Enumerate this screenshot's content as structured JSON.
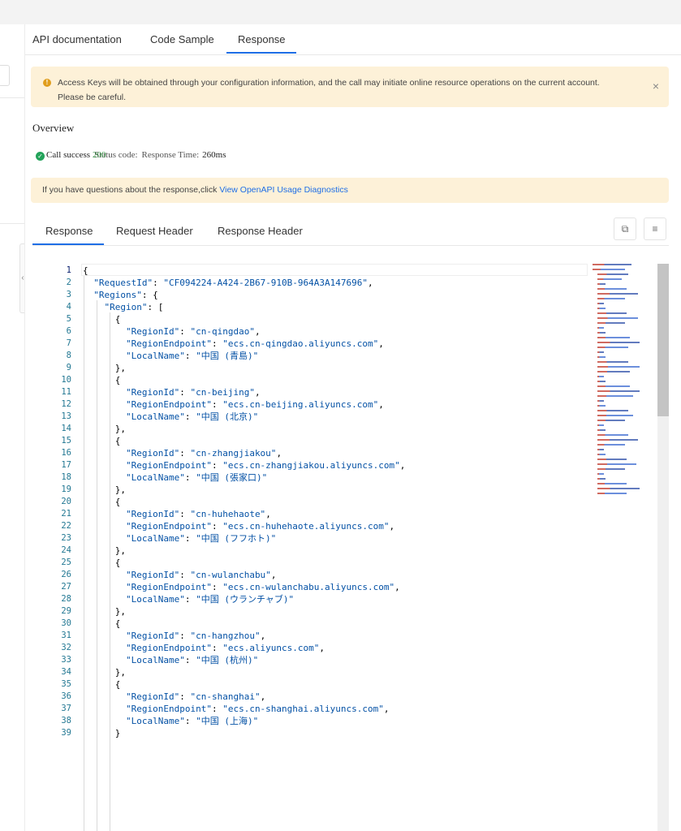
{
  "main_tabs": [
    "API documentation",
    "Code Sample",
    "Response"
  ],
  "warning": {
    "text": "Access Keys will be obtained through your configuration information, and the call may initiate online resource operations on the current account. Please be careful.",
    "close": "×"
  },
  "overview": {
    "title": "Overview",
    "call_status": "Call success",
    "status_code_label": "Status code:",
    "status_code": "200",
    "response_time_label": "Response Time:",
    "response_time": "260ms"
  },
  "hint": {
    "text": "If you have questions about the response,click ",
    "link": "View OpenAPI Usage Diagnostics"
  },
  "response_tabs": [
    "Response",
    "Request Header",
    "Response Header"
  ],
  "tool_icons": [
    "copy-icon",
    "format-icon"
  ],
  "colors": {
    "accent": "#1e6ee6",
    "warning_bg": "#fdf1d8",
    "success": "#23a35a",
    "json_key": "#0451a5",
    "line_number": "#237893"
  },
  "code_lines": [
    "{",
    "  \"RequestId\": \"CF094224-A424-2B67-910B-964A3A147696\",",
    "  \"Regions\": {",
    "    \"Region\": [",
    "      {",
    "        \"RegionId\": \"cn-qingdao\",",
    "        \"RegionEndpoint\": \"ecs.cn-qingdao.aliyuncs.com\",",
    "        \"LocalName\": \"中国 (青島)\"",
    "      },",
    "      {",
    "        \"RegionId\": \"cn-beijing\",",
    "        \"RegionEndpoint\": \"ecs.cn-beijing.aliyuncs.com\",",
    "        \"LocalName\": \"中国 (北京)\"",
    "      },",
    "      {",
    "        \"RegionId\": \"cn-zhangjiakou\",",
    "        \"RegionEndpoint\": \"ecs.cn-zhangjiakou.aliyuncs.com\",",
    "        \"LocalName\": \"中国 (張家口)\"",
    "      },",
    "      {",
    "        \"RegionId\": \"cn-huhehaote\",",
    "        \"RegionEndpoint\": \"ecs.cn-huhehaote.aliyuncs.com\",",
    "        \"LocalName\": \"中国 (フフホト)\"",
    "      },",
    "      {",
    "        \"RegionId\": \"cn-wulanchabu\",",
    "        \"RegionEndpoint\": \"ecs.cn-wulanchabu.aliyuncs.com\",",
    "        \"LocalName\": \"中国 (ウランチャブ)\"",
    "      },",
    "      {",
    "        \"RegionId\": \"cn-hangzhou\",",
    "        \"RegionEndpoint\": \"ecs.aliyuncs.com\",",
    "        \"LocalName\": \"中国 (杭州)\"",
    "      },",
    "      {",
    "        \"RegionId\": \"cn-shanghai\",",
    "        \"RegionEndpoint\": \"ecs.cn-shanghai.aliyuncs.com\",",
    "        \"LocalName\": \"中国 (上海)\"",
    "      }"
  ]
}
